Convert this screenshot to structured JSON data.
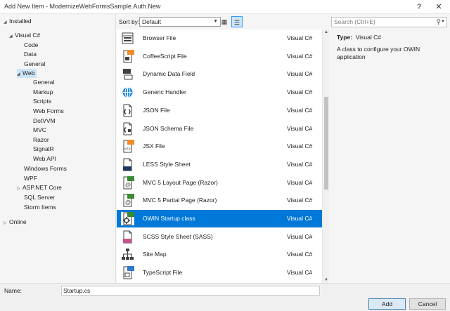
{
  "window": {
    "title": "Add New Item - ModernizeWebFormsSample.Auth.New",
    "help": "?",
    "close": "✕"
  },
  "tree": {
    "installed": "Installed",
    "visual_csharp": "Visual C#",
    "code": "Code",
    "data": "Data",
    "general": "General",
    "web": "Web",
    "web_children": [
      "General",
      "Markup",
      "Scripts",
      "Web Forms",
      "DotVVM",
      "MVC",
      "Razor",
      "SignalR",
      "Web API"
    ],
    "windows_forms": "Windows Forms",
    "wpf": "WPF",
    "aspnet_core": "ASP.NET Core",
    "sql_server": "SQL Server",
    "storm_items": "Storm Items",
    "online": "Online"
  },
  "toolbar": {
    "sort_label": "Sort by:",
    "sort_value": "Default"
  },
  "search": {
    "placeholder": "Search (Ctrl+E)"
  },
  "items": [
    {
      "name": "Browser File",
      "type": "Visual C#",
      "icon": "browser-file-icon"
    },
    {
      "name": "CoffeeScript File",
      "type": "Visual C#",
      "icon": "coffeescript-file-icon"
    },
    {
      "name": "Dynamic Data Field",
      "type": "Visual C#",
      "icon": "dynamic-data-field-icon"
    },
    {
      "name": "Generic Handler",
      "type": "Visual C#",
      "icon": "generic-handler-icon"
    },
    {
      "name": "JSON File",
      "type": "Visual C#",
      "icon": "json-file-icon"
    },
    {
      "name": "JSON Schema File",
      "type": "Visual C#",
      "icon": "json-schema-file-icon"
    },
    {
      "name": "JSX File",
      "type": "Visual C#",
      "icon": "jsx-file-icon"
    },
    {
      "name": "LESS Style Sheet",
      "type": "Visual C#",
      "icon": "less-style-sheet-icon"
    },
    {
      "name": "MVC 5 Layout Page (Razor)",
      "type": "Visual C#",
      "icon": "mvc-layout-page-icon"
    },
    {
      "name": "MVC 5 Partial Page (Razor)",
      "type": "Visual C#",
      "icon": "mvc-partial-page-icon"
    },
    {
      "name": "OWIN Startup class",
      "type": "Visual C#",
      "icon": "owin-startup-class-icon"
    },
    {
      "name": "SCSS Style Sheet (SASS)",
      "type": "Visual C#",
      "icon": "scss-style-sheet-icon"
    },
    {
      "name": "Site Map",
      "type": "Visual C#",
      "icon": "site-map-icon"
    },
    {
      "name": "TypeScript File",
      "type": "Visual C#",
      "icon": "typescript-file-icon"
    }
  ],
  "icon_badges": {
    "coffee": "JS",
    "jsx": "JS",
    "less": "LESS",
    "mvc": "C#",
    "owin": "C#",
    "scss": "SASS",
    "ts": "TS"
  },
  "selected_index": 10,
  "details": {
    "type_label": "Type:",
    "type_value": "Visual C#",
    "description": "A class to configure your OWIN application"
  },
  "bottom": {
    "name_label": "Name:",
    "name_value": "Startup.cs",
    "add": "Add",
    "cancel": "Cancel"
  },
  "colors": {
    "selection": "#0078d7",
    "tree_selection": "#cce4f7",
    "accent": "#3399ff"
  }
}
